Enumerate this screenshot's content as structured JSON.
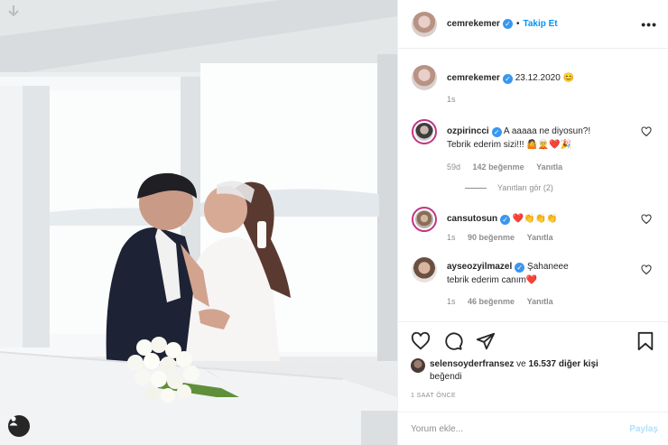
{
  "post": {
    "author": "cemrekemer",
    "follow_label": "Takip Et",
    "separator": "•",
    "more_label": "•••",
    "caption_date": "23.12.2020",
    "caption_emoji": "😊",
    "caption_age": "1s"
  },
  "comments": [
    {
      "user": "ozpirincci",
      "verified": true,
      "text_line1": "A aaaaa ne diyosun?!",
      "text_line2": "Tebrik ederim sizi!!!",
      "emoji": "🤷🧝❤️🎉",
      "age": "59d",
      "likes": "142 beğenme",
      "reply": "Yanıtla",
      "view_replies": "Yanıtları gör (2)"
    },
    {
      "user": "cansutosun",
      "verified": true,
      "text_line1": "",
      "emoji": "❤️👏👏👏",
      "age": "1s",
      "likes": "90 beğenme",
      "reply": "Yanıtla"
    },
    {
      "user": "ayseozyilmazel",
      "verified": true,
      "text_line1": "Şahaneee",
      "text_line2": "tebrik ederim canım",
      "emoji": "❤️",
      "age": "1s",
      "likes": "46 beğenme",
      "reply": "Yanıtla"
    }
  ],
  "likes": {
    "first_user": "selensoyderfransez",
    "conjunction": "ve",
    "others": "16.537 diğer kişi",
    "suffix": "beğendi"
  },
  "time_ago": "1 SAAT ÖNCE",
  "composer": {
    "placeholder": "Yorum ekle...",
    "post_label": "Paylaş"
  },
  "icons": {
    "like": "heart-icon",
    "comment": "comment-icon",
    "share": "share-icon",
    "save": "bookmark-icon",
    "tag": "user-tag-icon"
  },
  "colors": {
    "accent": "#0095f6",
    "verified": "#3897f0",
    "muted": "#8e8e8e",
    "like_red": "#ed4956"
  }
}
